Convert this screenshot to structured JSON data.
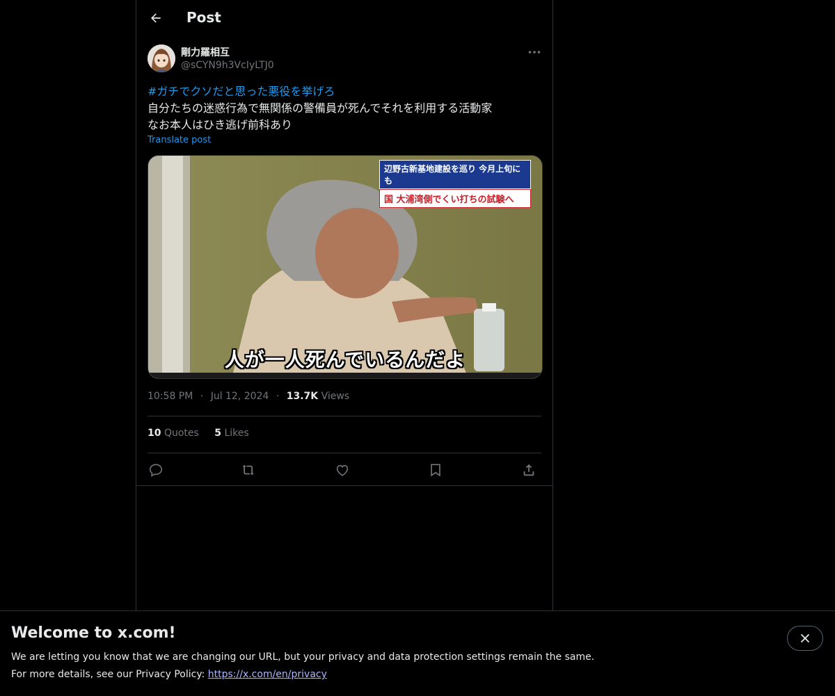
{
  "header": {
    "title": "Post",
    "back_icon": "arrow-left-icon"
  },
  "author": {
    "display_name": "剛力羅相互",
    "handle": "@sCYN9h3VcIyLTJ0"
  },
  "post": {
    "hashtag": "#ガチでクソだと思った悪役を挙げろ",
    "line1": "自分たちの迷惑行為で無関係の警備員が死んでそれを利用する活動家",
    "line2": "なお本人はひき逃げ前科あり",
    "translate_label": "Translate post"
  },
  "media": {
    "ticker_top": "辺野古新基地建設を巡り 今月上旬にも",
    "ticker_bottom": "国 大浦湾側でくい打ちの試験へ",
    "caption": "人が一人死んでいるんだよ"
  },
  "meta": {
    "time": "10:58 PM",
    "date": "Jul 12, 2024",
    "views_count": "13.7K",
    "views_label": "Views",
    "separator": "·"
  },
  "stats": {
    "quotes_count": "10",
    "quotes_label": "Quotes",
    "likes_count": "5",
    "likes_label": "Likes"
  },
  "actions": [
    "reply-icon",
    "repost-icon",
    "like-icon",
    "bookmark-icon",
    "share-icon"
  ],
  "banner": {
    "title": "Welcome to x.com!",
    "line1": "We are letting you know that we are changing our URL, but your privacy and data protection settings remain the same.",
    "line2_prefix": "For more details, see our Privacy Policy: ",
    "link": "https://x.com/en/privacy"
  },
  "colors": {
    "background": "#000000",
    "text": "#e7e9ea",
    "muted": "#71767b",
    "accent": "#1d9bf0",
    "border": "#2f3336",
    "link": "#a9b5ff"
  }
}
